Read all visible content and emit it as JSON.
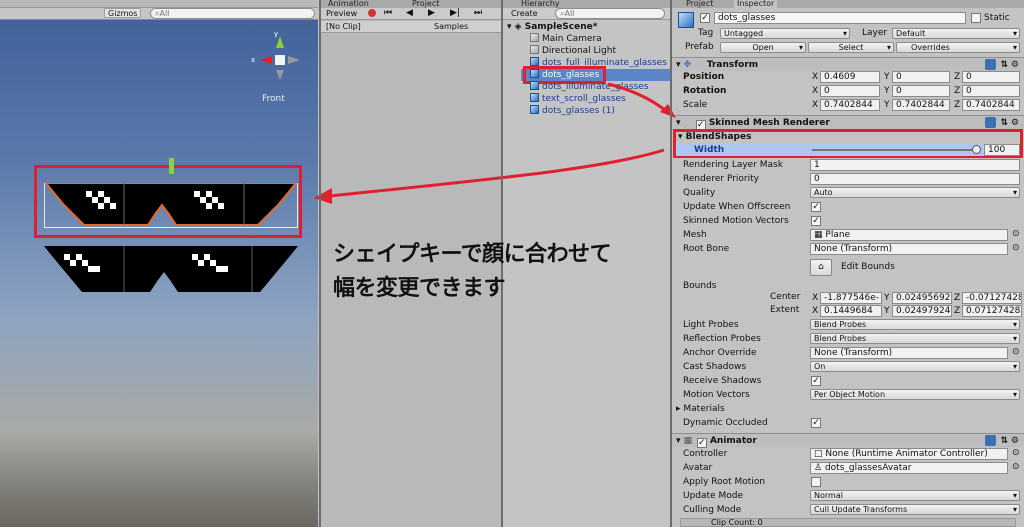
{
  "scene": {
    "gizmos_label": "Gizmos",
    "search_placeholder": "All",
    "view_label": "Front"
  },
  "animation": {
    "tab_label": "Animation",
    "project_tab_label": "Project",
    "preview_label": "Preview",
    "clip_label": "[No Clip]",
    "samples_label": "Samples"
  },
  "hierarchy": {
    "tab_label": "Hierarchy",
    "create_label": "Create",
    "search_placeholder": "All",
    "scene_name": "SampleScene*",
    "items": [
      {
        "label": "Main Camera"
      },
      {
        "label": "Directional Light"
      },
      {
        "label": "dots_full_illuminate_glasses"
      },
      {
        "label": "dots_glasses"
      },
      {
        "label": "dots_illuminate_glasses"
      },
      {
        "label": "text_scroll_glasses"
      },
      {
        "label": "dots_glasses (1)"
      }
    ]
  },
  "inspector": {
    "project_tab_label": "Project",
    "tab_label": "Inspector",
    "object_name": "dots_glasses",
    "static_label": "Static",
    "tag_label": "Tag",
    "tag_value": "Untagged",
    "layer_label": "Layer",
    "layer_value": "Default",
    "prefab_label": "Prefab",
    "open_label": "Open",
    "select_label": "Select",
    "overrides_label": "Overrides",
    "transform": {
      "title": "Transform",
      "position_label": "Position",
      "rotation_label": "Rotation",
      "scale_label": "Scale",
      "position": [
        "0.4609",
        "0",
        "0"
      ],
      "rotation": [
        "0",
        "0",
        "0"
      ],
      "scale": [
        "0.7402844",
        "0.7402844",
        "0.7402844"
      ]
    },
    "smr": {
      "title": "Skinned Mesh Renderer",
      "blendshapes_label": "BlendShapes",
      "width_label": "Width",
      "width_value": "100",
      "rendering_layer_mask_label": "Rendering Layer Mask",
      "rendering_layer_mask_value": "1",
      "renderer_priority_label": "Renderer Priority",
      "renderer_priority_value": "0",
      "quality_label": "Quality",
      "quality_value": "Auto",
      "update_offscreen_label": "Update When Offscreen",
      "skinned_motion_vectors_label": "Skinned Motion Vectors",
      "mesh_label": "Mesh",
      "mesh_value": "Plane",
      "root_bone_label": "Root Bone",
      "root_bone_value": "None (Transform)",
      "edit_bounds_label": "Edit Bounds",
      "bounds_label": "Bounds",
      "center_label": "Center",
      "extent_label": "Extent",
      "center": [
        "-1.877546e-",
        "0.02495692",
        "-0.07127428"
      ],
      "extent": [
        "0.1449684",
        "0.02497924",
        "0.07127428"
      ],
      "light_probes_label": "Light Probes",
      "light_probes_value": "Blend Probes",
      "reflection_probes_label": "Reflection Probes",
      "reflection_probes_value": "Blend Probes",
      "anchor_override_label": "Anchor Override",
      "anchor_override_value": "None (Transform)",
      "cast_shadows_label": "Cast Shadows",
      "cast_shadows_value": "On",
      "receive_shadows_label": "Receive Shadows",
      "motion_vectors_label": "Motion Vectors",
      "motion_vectors_value": "Per Object Motion",
      "materials_label": "Materials",
      "dynamic_occluded_label": "Dynamic Occluded"
    },
    "animator": {
      "title": "Animator",
      "controller_label": "Controller",
      "controller_value": "None (Runtime Animator Controller)",
      "avatar_label": "Avatar",
      "avatar_value": "dots_glassesAvatar",
      "apply_root_motion_label": "Apply Root Motion",
      "update_mode_label": "Update Mode",
      "update_mode_value": "Normal",
      "culling_mode_label": "Culling Mode",
      "culling_mode_value": "Cull Update Transforms",
      "clip_count": "Clip Count: 0"
    }
  },
  "annotation": {
    "line1": "シェイプキーで顔に合わせて",
    "line2": "幅を変更できます"
  },
  "colors": {
    "highlight": "#e0202e",
    "selection": "#5c85c8"
  }
}
